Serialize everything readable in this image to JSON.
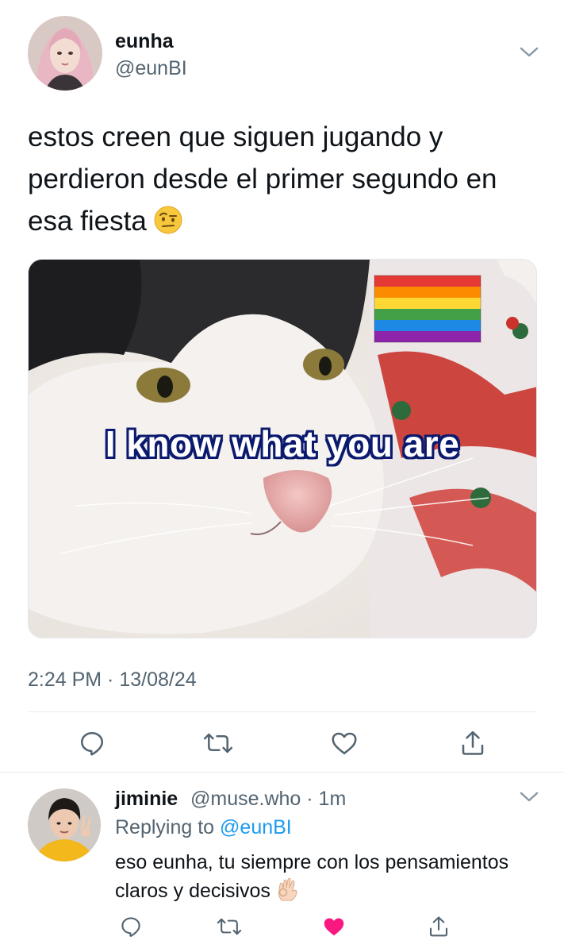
{
  "tweet": {
    "author_name": "eunha",
    "author_handle": "@eunBI",
    "text": "estos creen que siguen jugando y perdieron desde el primer segundo en esa fiesta",
    "emoji_icon": "raised-eyebrow-emoji",
    "image": {
      "caption": "I know what you are",
      "overlay_icon": "rainbow-flag-emoji"
    },
    "timestamp": "2:24 PM · 13/08/24",
    "actions": [
      "reply-icon",
      "retweet-icon",
      "like-icon",
      "share-icon"
    ]
  },
  "reply": {
    "author_name": "jiminie",
    "author_handle": "@muse.who · 1m",
    "replying_prefix": "Replying to ",
    "replying_to": "@eunBI",
    "text": "eso eunha, tu siempre con los pensamientos claros y decisivos",
    "emoji_icon": "ok-hand-emoji",
    "actions": [
      "reply-icon",
      "retweet-icon",
      "liked-heart-icon",
      "share-icon"
    ]
  },
  "colors": {
    "text_primary": "#0f1419",
    "text_secondary": "#536471",
    "link": "#1d9bf0",
    "like_active": "#f91880"
  }
}
